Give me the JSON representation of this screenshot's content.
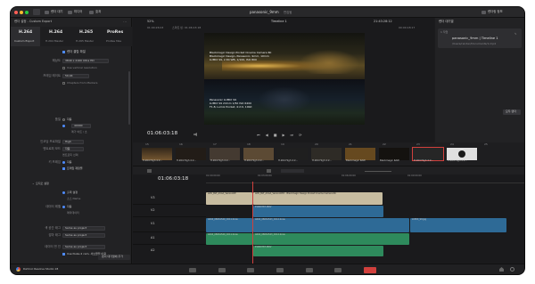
{
  "toolbar": {
    "app_icon": "media-pool-icon",
    "items": [
      "렌더 대기",
      "미디어",
      "효과"
    ],
    "project_name": "panasonic_9mm",
    "project_status": "편집됨",
    "right_item": "렌더링 정보"
  },
  "render": {
    "title": "렌더 설정 - Custom Export",
    "presets": [
      {
        "label": "H.264",
        "name": "Custom Export"
      },
      {
        "label": "H.264",
        "name": "H.264 Master"
      },
      {
        "label": "H.265",
        "name": "H.265 Master"
      },
      {
        "label": "ProRes",
        "name": "ProRes Mas"
      }
    ],
    "rows": [
      {
        "label": "",
        "value": "렌더 클립 파일"
      },
      {
        "label": "해상도",
        "value": "3840 x 2160 Ultra HD"
      },
      {
        "label": "",
        "value": "Use vertical resolution"
      },
      {
        "label": "프레임 레이트",
        "value": "59.94"
      },
      {
        "label": "",
        "value": "Chapters from Markers"
      },
      {
        "label": "품질",
        "value": "자동"
      },
      {
        "label": "",
        "value": "40000"
      },
      {
        "label": "",
        "value": "메가 비트 / 초"
      },
      {
        "label": "인코딩 프로파일",
        "value": "High"
      },
      {
        "label": "엔트로피 모드",
        "value": "자동"
      },
      {
        "label": "",
        "value": "엔트로피 선택"
      },
      {
        "label": "키 프레임",
        "value": "자동"
      },
      {
        "label": "",
        "value": "프레임 재정렬"
      },
      {
        "label": "",
        "value": "오디오 설정"
      },
      {
        "label": "",
        "value": "출력 설정"
      },
      {
        "label": "",
        "value": "소스 Name"
      },
      {
        "label": "데이터 레벨",
        "value": "자동"
      },
      {
        "label": "",
        "value": "메타데이터"
      },
      {
        "label": "색 공간 태그",
        "value": "Same as project"
      },
      {
        "label": "감마 태그",
        "value": "Same as project"
      },
      {
        "label": "데이터 번 인",
        "value": "Same as project"
      },
      {
        "label": "",
        "value": "Use Nuke-4 cam, 서브클립 이용"
      }
    ],
    "save_button": "렌더 대기열에 추가",
    "branding": "DaVinci Resolve Studio 18"
  },
  "viewer": {
    "zoom": "52%",
    "timeline_name": "Timeline 1",
    "left_timecode": "01:00:26:03",
    "clip_label": "스마트 빈: 01:06:13:18",
    "top_timecode": "21:43:28:12",
    "right_info": "00:00:18:17",
    "current_timecode": "01:06:03:18",
    "overlay_top_lines": [
      "Blackmagic Design Pocket Cinema Camera 6K",
      "Blackmagic Design, Panasonic, 9mm, 10mm",
      "LUMIX S9, 2.84 WB, 1/100, ISO 800"
    ],
    "overlay_bottom_lines": [
      "Panasonic LUMIX S9",
      "LUMIX S9 24mm 1/50 ISO 6400",
      "F1.8, Lumix Pocket, 4:2:0, 10bit"
    ]
  },
  "render_queue": {
    "title": "렌더 대기열",
    "job_label": "1 작업",
    "job_name": "panasonic_9mm | Timeline 1",
    "job_path": "/Users/render/Documents/1.mp4",
    "render_button": "모두 렌더"
  },
  "clips_strip": {
    "markers": [
      "15",
      "16",
      "17",
      "18",
      "19",
      "20",
      "21",
      "22",
      "23",
      "24",
      "25"
    ],
    "labels": [
      "H.264 High 4:2...",
      "H.264 High 4:2...",
      "H.264 High 4:2...",
      "H.264 High 4:2...",
      "H.264 High 4:2...",
      "H.264 High 4:2...",
      "Blackmagic RAW",
      "Blackmagic RAW",
      "H.264 High 4:2...",
      "H.264 High 4:2..."
    ],
    "colors": [
      "#3e3020",
      "#221c17",
      "#443a31",
      "#5c4a34",
      "#1f1f1f",
      "#2e2b26",
      "#66491f",
      "#14120f",
      "#e0e0e0",
      "#262626"
    ]
  },
  "timeline": {
    "timecode": "01:06:03:18",
    "ruler": [
      "01:00:00:00",
      "01:03:00:00",
      "01:06:00:00",
      "01:09:00:00"
    ],
    "tracks": [
      {
        "id": "V3",
        "label": "비디오 3"
      },
      {
        "id": "V2",
        "label": "비디오 2"
      },
      {
        "id": "V1",
        "label": "비디오 1"
      },
      {
        "id": "A1",
        "label": "오디오 1"
      },
      {
        "id": "A2",
        "label": "오디오 2"
      }
    ],
    "v3_clips": [
      "ADV_BLT_AUAA_VersionDE",
      "ADV_BLT_AUAA_VersionDE2 - Blackmagic Design Pocket Cinema Camera 6K"
    ],
    "v2_clip": "P1000787.MOV",
    "v1_clips": [
      "A004_08061540_C011.braw",
      "A004_08061543_C012.braw",
      "LUMIX_S9.jpg"
    ],
    "a1_clips": [
      "A004_08061540_C011.braw",
      "A004_08061543_C012.braw"
    ],
    "a2_clip": "P1000787.MOV"
  },
  "bottom_bar": {
    "tabs": [
      "media-icon",
      "cut-icon",
      "edit-icon",
      "fusion-icon",
      "color-icon",
      "fairlight-icon",
      "deliver-icon"
    ],
    "active_tab": "deliver-icon"
  },
  "colors": {
    "accent": "#4e8cff",
    "active": "#d1403d",
    "audio": "#2e8a5c",
    "video": "#2e6a96",
    "v3": "#c7bca0"
  }
}
